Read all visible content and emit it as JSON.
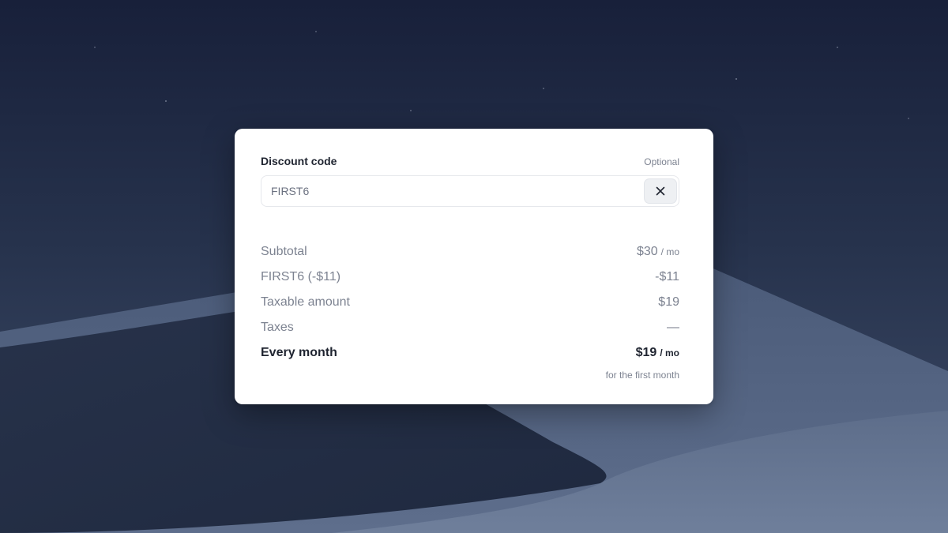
{
  "discount": {
    "label": "Discount code",
    "optional_text": "Optional",
    "code_value": "FIRST6",
    "clear_icon": "close-icon"
  },
  "summary": {
    "subtotal": {
      "label": "Subtotal",
      "amount": "$30",
      "unit": "/ mo"
    },
    "discount_line": {
      "label": "FIRST6 (-$11)",
      "amount": "-$11"
    },
    "taxable": {
      "label": "Taxable amount",
      "amount": "$19"
    },
    "taxes": {
      "label": "Taxes",
      "amount": "—"
    },
    "total": {
      "label": "Every month",
      "amount": "$19",
      "unit": "/ mo",
      "note": "for the first month"
    }
  }
}
